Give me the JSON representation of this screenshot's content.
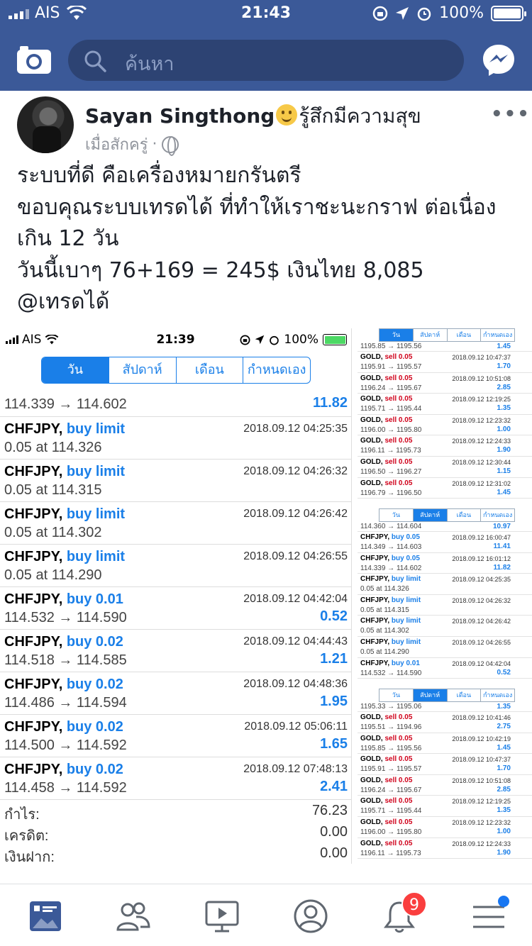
{
  "status_bar": {
    "carrier": "AIS",
    "time": "21:43",
    "battery_pct": "100%"
  },
  "fb_header": {
    "search_placeholder": "ค้นหา"
  },
  "post": {
    "author": "Sayan Singthong",
    "feeling": "รู้สึกมีความสุข",
    "time": "เมื่อสักครู่",
    "separator": "·",
    "more": "•••",
    "lines": [
      "ระบบที่ดี คือเครื่องหมายกรันตรี",
      "ขอบคุณระบบเทรดได้ ที่ทำให้เราชะนะกราฟ ต่อเนื่อง",
      "เกิน 12 วัน",
      "วันนี้เบาๆ 76+169 = 245$ เงินไทย 8,085",
      "@เทรดได้"
    ]
  },
  "screenshot": {
    "status": {
      "carrier": "AIS",
      "time": "21:39",
      "battery_pct": "100%"
    },
    "tabs": [
      "วัน",
      "สัปดาห์",
      "เดือน",
      "กำหนดเอง"
    ],
    "first_row": {
      "prices": "114.339 → 114.602",
      "profit": "11.82"
    },
    "rows": [
      {
        "symbol": "CHFJPY,",
        "action": "buy limit",
        "datetime": "2018.09.12 04:25:35",
        "prices": "0.05 at 114.326",
        "profit": ""
      },
      {
        "symbol": "CHFJPY,",
        "action": "buy limit",
        "datetime": "2018.09.12 04:26:32",
        "prices": "0.05 at 114.315",
        "profit": ""
      },
      {
        "symbol": "CHFJPY,",
        "action": "buy limit",
        "datetime": "2018.09.12 04:26:42",
        "prices": "0.05 at 114.302",
        "profit": ""
      },
      {
        "symbol": "CHFJPY,",
        "action": "buy limit",
        "datetime": "2018.09.12 04:26:55",
        "prices": "0.05 at 114.290",
        "profit": ""
      },
      {
        "symbol": "CHFJPY,",
        "action": "buy 0.01",
        "datetime": "2018.09.12 04:42:04",
        "prices": "114.532 → 114.590",
        "profit": "0.52"
      },
      {
        "symbol": "CHFJPY,",
        "action": "buy 0.02",
        "datetime": "2018.09.12 04:44:43",
        "prices": "114.518 → 114.585",
        "profit": "1.21"
      },
      {
        "symbol": "CHFJPY,",
        "action": "buy 0.02",
        "datetime": "2018.09.12 04:48:36",
        "prices": "114.486 → 114.594",
        "profit": "1.95"
      },
      {
        "symbol": "CHFJPY,",
        "action": "buy 0.02",
        "datetime": "2018.09.12 05:06:11",
        "prices": "114.500 → 114.592",
        "profit": "1.65"
      },
      {
        "symbol": "CHFJPY,",
        "action": "buy 0.02",
        "datetime": "2018.09.12 07:48:13",
        "prices": "114.458 → 114.592",
        "profit": "2.41"
      }
    ],
    "summary": [
      {
        "label": "กำไร:",
        "value": "76.23"
      },
      {
        "label": "เครดิต:",
        "value": "0.00"
      },
      {
        "label": "เงินฝาก:",
        "value": "0.00"
      }
    ]
  },
  "mini1": {
    "tabs": [
      "วัน",
      "สัปดาห์",
      "เดือน",
      "กำหนดเอง"
    ],
    "first": {
      "prices": "1195.85 → 1195.56",
      "profit": "1.45"
    },
    "rows": [
      {
        "symbol": "GOLD,",
        "action": "sell 0.05",
        "datetime": "2018.09.12 10:47:37",
        "prices": "1195.91 → 1195.57",
        "profit": "1.70"
      },
      {
        "symbol": "GOLD,",
        "action": "sell 0.05",
        "datetime": "2018.09.12 10:51:08",
        "prices": "1196.24 → 1195.67",
        "profit": "2.85"
      },
      {
        "symbol": "GOLD,",
        "action": "sell 0.05",
        "datetime": "2018.09.12 12:19:25",
        "prices": "1195.71 → 1195.44",
        "profit": "1.35"
      },
      {
        "symbol": "GOLD,",
        "action": "sell 0.05",
        "datetime": "2018.09.12 12:23:32",
        "prices": "1196.00 → 1195.80",
        "profit": "1.00"
      },
      {
        "symbol": "GOLD,",
        "action": "sell 0.05",
        "datetime": "2018.09.12 12:24:33",
        "prices": "1196.11 → 1195.73",
        "profit": "1.90"
      },
      {
        "symbol": "GOLD,",
        "action": "sell 0.05",
        "datetime": "2018.09.12 12:30:44",
        "prices": "1196.50 → 1196.27",
        "profit": "1.15"
      },
      {
        "symbol": "GOLD,",
        "action": "sell 0.05",
        "datetime": "2018.09.12 12:31:02",
        "prices": "1196.79 → 1196.50",
        "profit": "1.45"
      }
    ]
  },
  "mini2": {
    "tabs": [
      "วัน",
      "สัปดาห์",
      "เดือน",
      "กำหนดเอง"
    ],
    "first": {
      "prices": "114.360 → 114.604",
      "profit": "10.97"
    },
    "rows": [
      {
        "symbol": "CHFJPY,",
        "action": "buy 0.05",
        "datetime": "2018.09.12 16:00:47",
        "prices": "114.349 → 114.603",
        "profit": "11.41"
      },
      {
        "symbol": "CHFJPY,",
        "action": "buy 0.05",
        "datetime": "2018.09.12 16:01:12",
        "prices": "114.339 → 114.602",
        "profit": "11.82"
      },
      {
        "symbol": "CHFJPY,",
        "action": "buy limit",
        "datetime": "2018.09.12 04:25:35",
        "prices": "0.05 at 114.326",
        "profit": ""
      },
      {
        "symbol": "CHFJPY,",
        "action": "buy limit",
        "datetime": "2018.09.12 04:26:32",
        "prices": "0.05 at 114.315",
        "profit": ""
      },
      {
        "symbol": "CHFJPY,",
        "action": "buy limit",
        "datetime": "2018.09.12 04:26:42",
        "prices": "0.05 at 114.302",
        "profit": ""
      },
      {
        "symbol": "CHFJPY,",
        "action": "buy limit",
        "datetime": "2018.09.12 04:26:55",
        "prices": "0.05 at 114.290",
        "profit": ""
      },
      {
        "symbol": "CHFJPY,",
        "action": "buy 0.01",
        "datetime": "2018.09.12 04:42:04",
        "prices": "114.532 → 114.590",
        "profit": "0.52"
      }
    ]
  },
  "mini3": {
    "tabs": [
      "วัน",
      "สัปดาห์",
      "เดือน",
      "กำหนดเอง"
    ],
    "first": {
      "prices": "1195.33 → 1195.06",
      "profit": "1.35"
    },
    "rows": [
      {
        "symbol": "GOLD,",
        "action": "sell 0.05",
        "datetime": "2018.09.12 10:41:46",
        "prices": "1195.51 → 1194.96",
        "profit": "2.75"
      },
      {
        "symbol": "GOLD,",
        "action": "sell 0.05",
        "datetime": "2018.09.12 10:42:19",
        "prices": "1195.85 → 1195.56",
        "profit": "1.45"
      },
      {
        "symbol": "GOLD,",
        "action": "sell 0.05",
        "datetime": "2018.09.12 10:47:37",
        "prices": "1195.91 → 1195.57",
        "profit": "1.70"
      },
      {
        "symbol": "GOLD,",
        "action": "sell 0.05",
        "datetime": "2018.09.12 10:51:08",
        "prices": "1196.24 → 1195.67",
        "profit": "2.85"
      },
      {
        "symbol": "GOLD,",
        "action": "sell 0.05",
        "datetime": "2018.09.12 12:19:25",
        "prices": "1195.71 → 1195.44",
        "profit": "1.35"
      },
      {
        "symbol": "GOLD,",
        "action": "sell 0.05",
        "datetime": "2018.09.12 12:23:32",
        "prices": "1196.00 → 1195.80",
        "profit": "1.00"
      },
      {
        "symbol": "GOLD,",
        "action": "sell 0.05",
        "datetime": "2018.09.12 12:24:33",
        "prices": "1196.11 → 1195.73",
        "profit": "1.90"
      }
    ]
  },
  "tabbar": {
    "items": [
      "news-feed-icon",
      "friends-icon",
      "watch-icon",
      "profile-icon",
      "notifications-icon",
      "menu-icon"
    ],
    "notification_count": "9"
  },
  "colors": {
    "fb_blue": "#3b5998",
    "buy_blue": "#1a7fe8",
    "sell_red": "#d0021b",
    "badge_red": "#fa3e3e"
  }
}
